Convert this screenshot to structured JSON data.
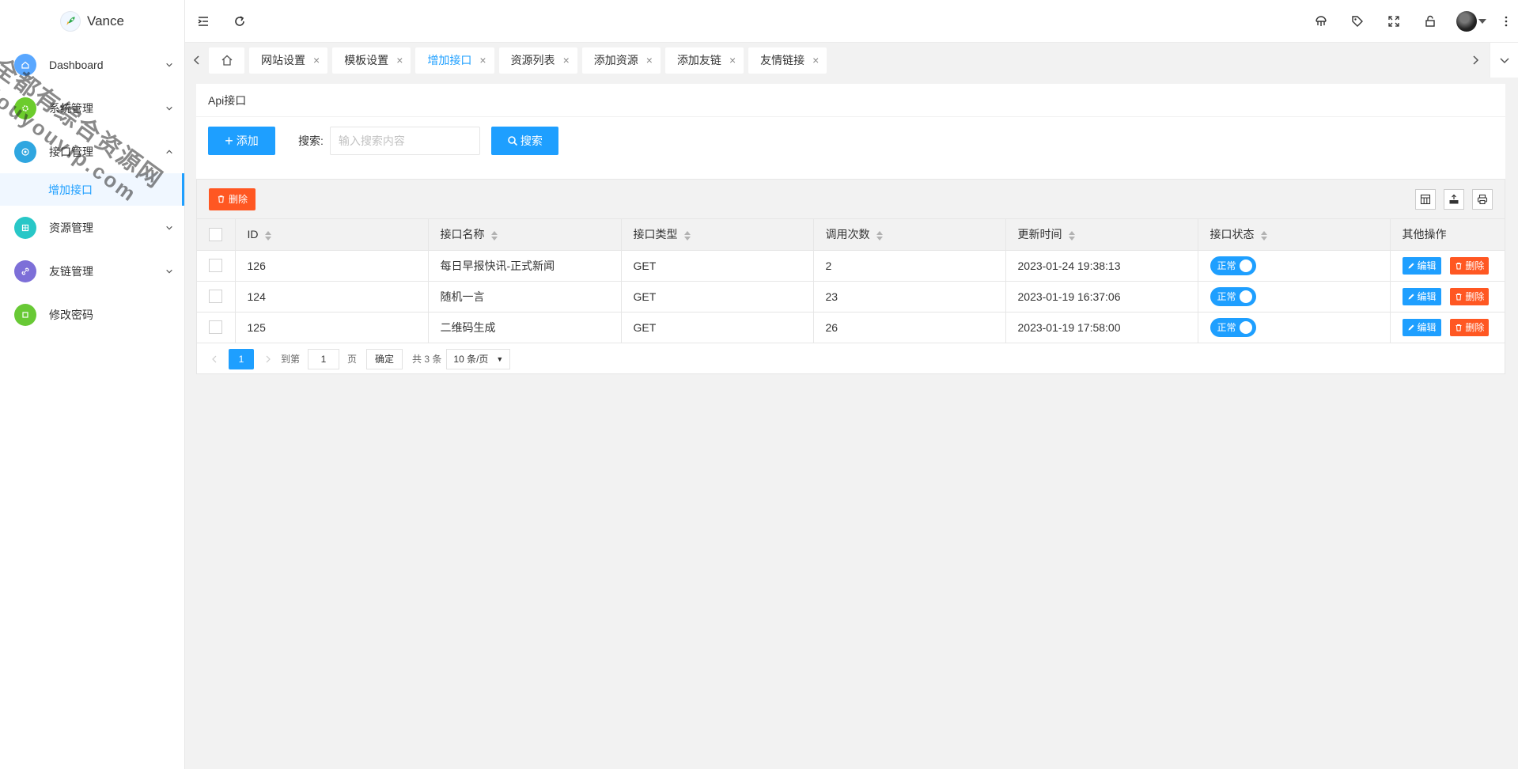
{
  "app": {
    "brand": "Vance"
  },
  "sidebar": {
    "items": [
      {
        "label": "Dashboard",
        "icon": "home-icon",
        "color": "#59a7ff"
      },
      {
        "label": "系统管理",
        "icon": "gear-icon",
        "color": "#6ccc2c"
      },
      {
        "label": "接口管理",
        "icon": "api-icon",
        "color": "#2fa6e0",
        "expanded": true
      },
      {
        "label": "资源管理",
        "icon": "grid-icon",
        "color": "#28c7c7"
      },
      {
        "label": "友链管理",
        "icon": "link-icon",
        "color": "#7d6fd8"
      },
      {
        "label": "修改密码",
        "icon": "key-icon",
        "color": "#68c935"
      }
    ],
    "sub_item": "增加接口"
  },
  "watermark": {
    "line1": "全都有综合资源网",
    "line2": "douyouvip.com"
  },
  "tabs": [
    {
      "label": "网站设置"
    },
    {
      "label": "模板设置"
    },
    {
      "label": "增加接口",
      "active": true
    },
    {
      "label": "资源列表"
    },
    {
      "label": "添加资源"
    },
    {
      "label": "添加友链"
    },
    {
      "label": "友情链接"
    }
  ],
  "page": {
    "title": "Api接口",
    "add_label": "添加",
    "search_label": "搜索:",
    "search_placeholder": "输入搜索内容",
    "search_button": "搜索",
    "delete_label": "删除"
  },
  "table": {
    "headers": [
      "ID",
      "接口名称",
      "接口类型",
      "调用次数",
      "更新时间",
      "接口状态",
      "其他操作"
    ],
    "rows": [
      {
        "id": "126",
        "name": "每日早报快讯-正式新闻",
        "type": "GET",
        "count": "2",
        "time": "2023-01-24 19:38:13",
        "status": "正常"
      },
      {
        "id": "124",
        "name": "随机一言",
        "type": "GET",
        "count": "23",
        "time": "2023-01-19 16:37:06",
        "status": "正常"
      },
      {
        "id": "125",
        "name": "二维码生成",
        "type": "GET",
        "count": "26",
        "time": "2023-01-19 17:58:00",
        "status": "正常"
      }
    ],
    "edit_label": "编辑",
    "delete_label": "删除"
  },
  "pager": {
    "current": "1",
    "goto_label": "到第",
    "goto_value": "1",
    "page_label": "页",
    "confirm_label": "确定",
    "total_label": "共 3 条",
    "per_page": "10 条/页"
  },
  "colors": {
    "primary": "#1e9fff",
    "danger": "#ff5722"
  }
}
